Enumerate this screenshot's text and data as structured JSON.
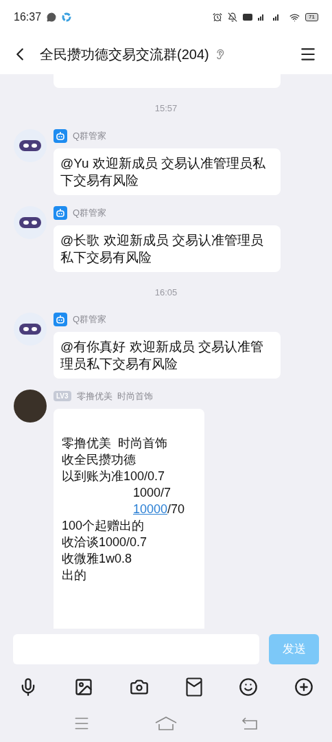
{
  "status_bar": {
    "time": "16:37",
    "battery": "71"
  },
  "header": {
    "title": "全民攒功德交易交流群(204)"
  },
  "messages": [
    {
      "kind": "partial"
    },
    {
      "kind": "time",
      "text": "15:57"
    },
    {
      "kind": "bot",
      "sender": "Q群管家",
      "text": "@Yu 欢迎新成员 交易认准管理员私下交易有风险"
    },
    {
      "kind": "bot",
      "sender": "Q群管家",
      "text": "@长歌 欢迎新成员 交易认准管理员私下交易有风险"
    },
    {
      "kind": "time",
      "text": "16:05"
    },
    {
      "kind": "bot",
      "sender": "Q群管家",
      "text": "@有你真好 欢迎新成员 交易认准管理员私下交易有风险"
    },
    {
      "kind": "member",
      "level": "LV3",
      "sender": "零撸优美  时尚首饰",
      "lines": [
        {
          "indent": false,
          "parts": [
            {
              "text": "零撸优美  时尚首饰",
              "link": false
            }
          ]
        },
        {
          "indent": false,
          "parts": [
            {
              "text": "收全民攒功德",
              "link": false
            }
          ]
        },
        {
          "indent": false,
          "parts": [
            {
              "text": "以到账为准100/0.7",
              "link": false
            }
          ]
        },
        {
          "indent": true,
          "parts": [
            {
              "text": "1000/7",
              "link": false
            }
          ]
        },
        {
          "indent": true,
          "parts": [
            {
              "text": "10000",
              "link": true
            },
            {
              "text": "/70",
              "link": false
            }
          ]
        },
        {
          "indent": false,
          "parts": [
            {
              "text": "100个起赠出的",
              "link": false
            }
          ]
        },
        {
          "indent": false,
          "parts": [
            {
              "text": "收洽谈1000/0.7",
              "link": false
            }
          ]
        },
        {
          "indent": false,
          "parts": [
            {
              "text": "收微雅1w0.8",
              "link": false
            }
          ]
        },
        {
          "indent": false,
          "parts": [
            {
              "text": "出的",
              "link": false
            }
          ]
        }
      ]
    }
  ],
  "composer": {
    "send": "发送"
  }
}
